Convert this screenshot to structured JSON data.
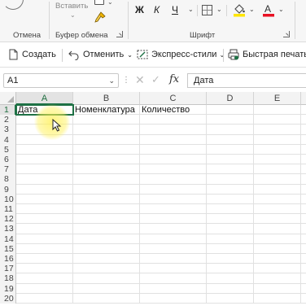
{
  "ribbon": {
    "groups": {
      "undo": "Отмена",
      "clipboard": "Буфер обмена",
      "font": "Шрифт"
    },
    "paste_label": "Вставить",
    "bold": "Ж",
    "italic": "К",
    "underline": "Ч",
    "font_color_letter": "А",
    "colors": {
      "highlight": "#ffe500",
      "font_color": "#e81123"
    }
  },
  "quickbar": {
    "create": "Создать",
    "undo": "Отменить",
    "express_styles": "Экспресс-стили",
    "quick_print": "Быстрая печать"
  },
  "formula_bar": {
    "name_box": "A1",
    "formula": "Дата"
  },
  "sheet": {
    "columns": [
      "A",
      "B",
      "C",
      "D",
      "E"
    ],
    "rows": [
      "1",
      "2",
      "3",
      "4",
      "5",
      "6",
      "7",
      "8",
      "9",
      "10",
      "11",
      "12",
      "13",
      "14",
      "15",
      "16",
      "17",
      "18",
      "19",
      "20"
    ],
    "row1": {
      "A": "Дата",
      "B": "Номенклатура",
      "C": "Количество"
    },
    "active_cell": "A1",
    "accent_color": "#1e7145"
  }
}
